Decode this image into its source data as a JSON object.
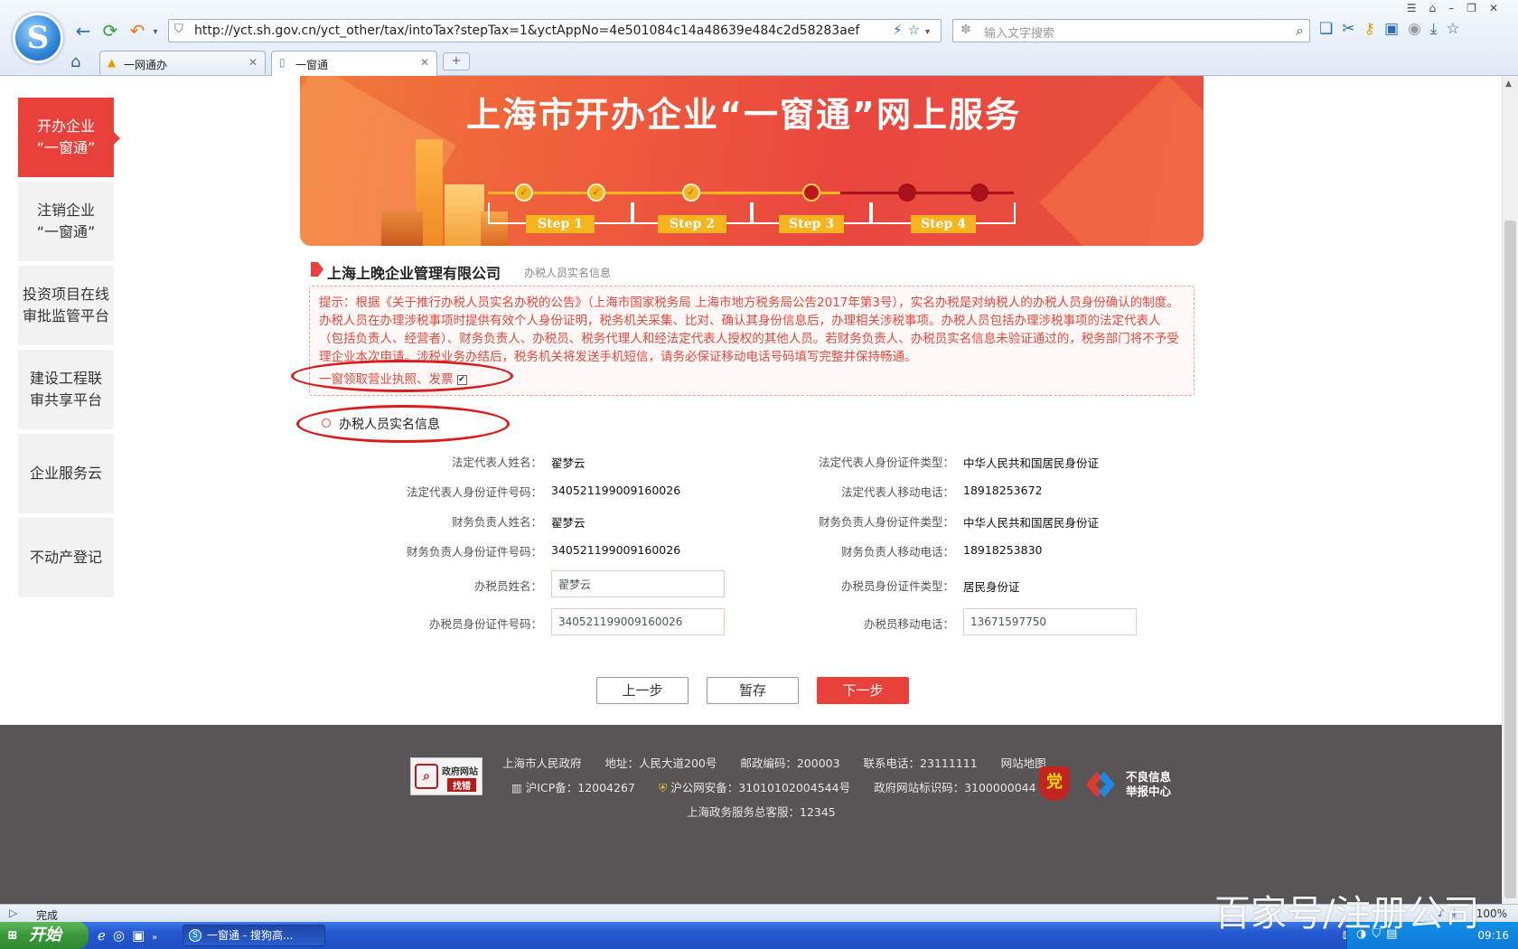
{
  "browser": {
    "url": "http://yct.sh.gov.cn/yct_other/tax/intoTax?stepTax=1&yctAppNo=4e501084c14a48639e484c2d58283aef",
    "search_placeholder": "输入文字搜索",
    "tabs": [
      {
        "label": "一网通办"
      },
      {
        "label": "一窗通"
      }
    ],
    "status": "完成",
    "zoom": "100%"
  },
  "sidebar": {
    "items": [
      {
        "label": "开办企业\n“一窗通”",
        "active": true
      },
      {
        "label": "注销企业\n“一窗通”",
        "active": false
      },
      {
        "label": "投资项目在线\n审批监管平台",
        "active": false
      },
      {
        "label": "建设工程联\n审共享平台",
        "active": false
      },
      {
        "label": "企业服务云",
        "active": false
      },
      {
        "label": "不动产登记",
        "active": false
      }
    ]
  },
  "banner": {
    "title": "上海市开办企业“一窗通”网上服务",
    "steps": [
      "Step 1",
      "Step 2",
      "Step 3",
      "Step 4"
    ]
  },
  "company": {
    "name": "上海上晚企业管理有限公司",
    "subtitle": "办税人员实名信息"
  },
  "notice": {
    "text": "提示：根据《关于推行办税人员实名办税的公告》（上海市国家税务局 上海市地方税务局公告2017年第3号），实名办税是对纳税人的办税人员身份确认的制度。办税人员在办理涉税事项时提供有效个人身份证明，税务机关采集、比对、确认其身份信息后，办理相关涉税事项。办税人员包括办理涉税事项的法定代表人（包括负责人、经营者）、财务负责人、办税员、税务代理人和经法定代表人授权的其他人员。若财务负责人、办税员实名信息未验证通过的，税务部门将不予受理企业本次申请。涉税业务办结后，税务机关将发送手机短信，请务必保证移动电话号码填写完整并保持畅通。",
    "checkbox_label": "一窗领取营业执照、发票"
  },
  "section": {
    "title": "办税人员实名信息"
  },
  "form": {
    "legal_name_label": "法定代表人姓名：",
    "legal_name": "翟梦云",
    "legal_idtype_label": "法定代表人身份证件类型：",
    "legal_idtype": "中华人民共和国居民身份证",
    "legal_idno_label": "法定代表人身份证件号码：",
    "legal_idno": "340521199009160026",
    "legal_phone_label": "法定代表人移动电话：",
    "legal_phone": "18918253672",
    "fin_name_label": "财务负责人姓名：",
    "fin_name": "翟梦云",
    "fin_idtype_label": "财务负责人身份证件类型：",
    "fin_idtype": "中华人民共和国居民身份证",
    "fin_idno_label": "财务负责人身份证件号码：",
    "fin_idno": "340521199009160026",
    "fin_phone_label": "财务负责人移动电话：",
    "fin_phone": "18918253830",
    "tax_name_label": "办税员姓名：",
    "tax_name": "翟梦云",
    "tax_idtype_label": "办税员身份证件类型：",
    "tax_idtype": "居民身份证",
    "tax_idno_label": "办税员身份证件号码：",
    "tax_idno": "340521199009160026",
    "tax_phone_label": "办税员移动电话：",
    "tax_phone": "13671597750"
  },
  "buttons": {
    "prev": "上一步",
    "save": "暂存",
    "next": "下一步"
  },
  "footer": {
    "badge_line1": "政府网站",
    "badge_line2": "找错",
    "line1": [
      "上海市人民政府",
      "地址：人民大道200号",
      "邮政编码：200003",
      "联系电话：23111111",
      "网站地图"
    ],
    "line2": [
      "沪ICP备：12004267",
      "沪公网安备：31010102004544号",
      "政府网站标识码：3100000044"
    ],
    "line3": "上海政务服务总客服：12345",
    "report_line1": "不良信息",
    "report_line2": "举报中心"
  },
  "taskbar": {
    "start": "开始",
    "task_label": "一窗通 - 搜狗高...",
    "clock": "09:16"
  },
  "watermark": "百家号/注册公司"
}
